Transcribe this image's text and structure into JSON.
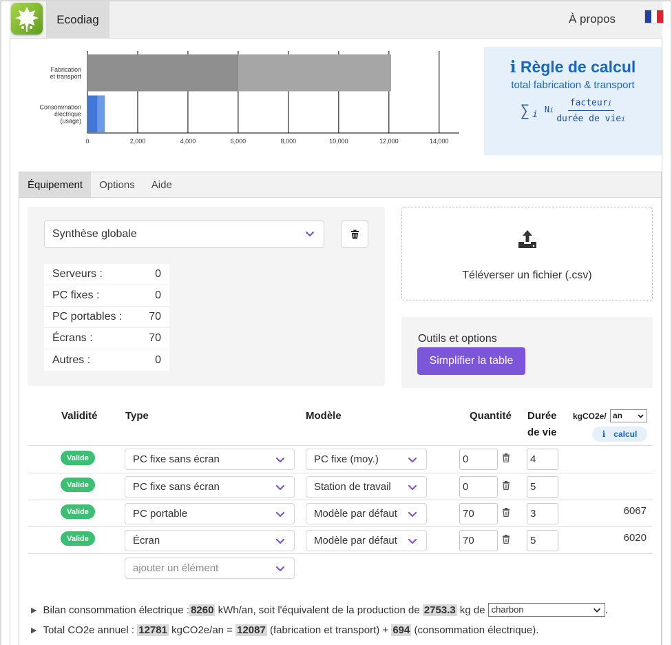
{
  "navbar": {
    "brand": "Ecodiag",
    "about": "À propos"
  },
  "chart_data": {
    "type": "bar",
    "orientation": "horizontal",
    "stacked": true,
    "categories": [
      "Fabrication et transport",
      "Consommation électrique (usage)"
    ],
    "category_lines": [
      [
        "Fabrication",
        "et transport"
      ],
      [
        "Consommation",
        "électrique",
        "(usage)"
      ]
    ],
    "series": [
      {
        "values": [
          6000,
          400
        ],
        "color": "#909090"
      },
      {
        "values": [
          6087,
          294
        ],
        "color": "#a8a8a8"
      }
    ],
    "bar_colors": [
      [
        "#8f8f8f",
        "#a6a6a6"
      ],
      [
        "#3f78d6",
        "#6b9ae6"
      ]
    ],
    "xlim": [
      0,
      14800
    ],
    "xticks": [
      0,
      2000,
      4000,
      6000,
      8000,
      10000,
      12000,
      14000
    ],
    "xtick_labels": [
      "0",
      "2,000",
      "4,000",
      "6,000",
      "8,000",
      "10,000",
      "12,000",
      "14,000"
    ],
    "grid": true
  },
  "info": {
    "icon": "i",
    "title": "Règle de calcul",
    "subtitle": "total fabrication & transport",
    "formula_sum": "∑",
    "formula_sub": "i",
    "formula_ni": "N",
    "formula_num": "facteur",
    "formula_den": "durée de vie"
  },
  "tabs": [
    "Équipement",
    "Options",
    "Aide"
  ],
  "left_card": {
    "select_value": "Synthèse globale",
    "summary": [
      {
        "label": "Serveurs :",
        "value": "0"
      },
      {
        "label": "PC fixes :",
        "value": "0"
      },
      {
        "label": "PC portables :",
        "value": "70"
      },
      {
        "label": "Écrans :",
        "value": "70"
      },
      {
        "label": "Autres :",
        "value": "0"
      }
    ]
  },
  "upload": {
    "label": "Téléverser un fichier (.csv)"
  },
  "tools": {
    "label": "Outils et options",
    "button": "Simplifier la table"
  },
  "table": {
    "headers": {
      "validity": "Validité",
      "type": "Type",
      "model": "Modèle",
      "quantity": "Quantité",
      "lifetime_1": "Durée",
      "lifetime_2": "de vie",
      "unit": "kgCO2e/",
      "unit_select": "an",
      "calc_icon": "i",
      "calc": "calcul"
    },
    "rows": [
      {
        "status": "Valide",
        "type": "PC fixe sans écran",
        "model": "PC fixe (moy.)",
        "qty": "0",
        "life": "4",
        "value": ""
      },
      {
        "status": "Valide",
        "type": "PC fixe sans écran",
        "model": "Station de travail",
        "qty": "0",
        "life": "5",
        "value": ""
      },
      {
        "status": "Valide",
        "type": "PC portable",
        "model": "Modèle par défaut",
        "qty": "70",
        "life": "3",
        "value": "6067"
      },
      {
        "status": "Valide",
        "type": "Écran",
        "model": "Modèle par défaut",
        "qty": "70",
        "life": "5",
        "value": "6020"
      }
    ],
    "add_placeholder": "ajouter un élément"
  },
  "bilan": {
    "elec_pre": "Bilan consommation électrique : ",
    "elec_kwh": "8260",
    "elec_mid": " kWh/an, soit l'équivalent de la production de ",
    "elec_kg": "2753.3",
    "elec_post": " kg de",
    "fuel": "charbon",
    "elec_end": ".",
    "total_pre": "Total CO2e annuel : ",
    "total": "12781",
    "total_mid": " kgCO2e/an = ",
    "fab": "12087",
    "fab_post": " (fabrication et transport) + ",
    "conso": "694",
    "conso_post": " (consommation électrique)."
  }
}
